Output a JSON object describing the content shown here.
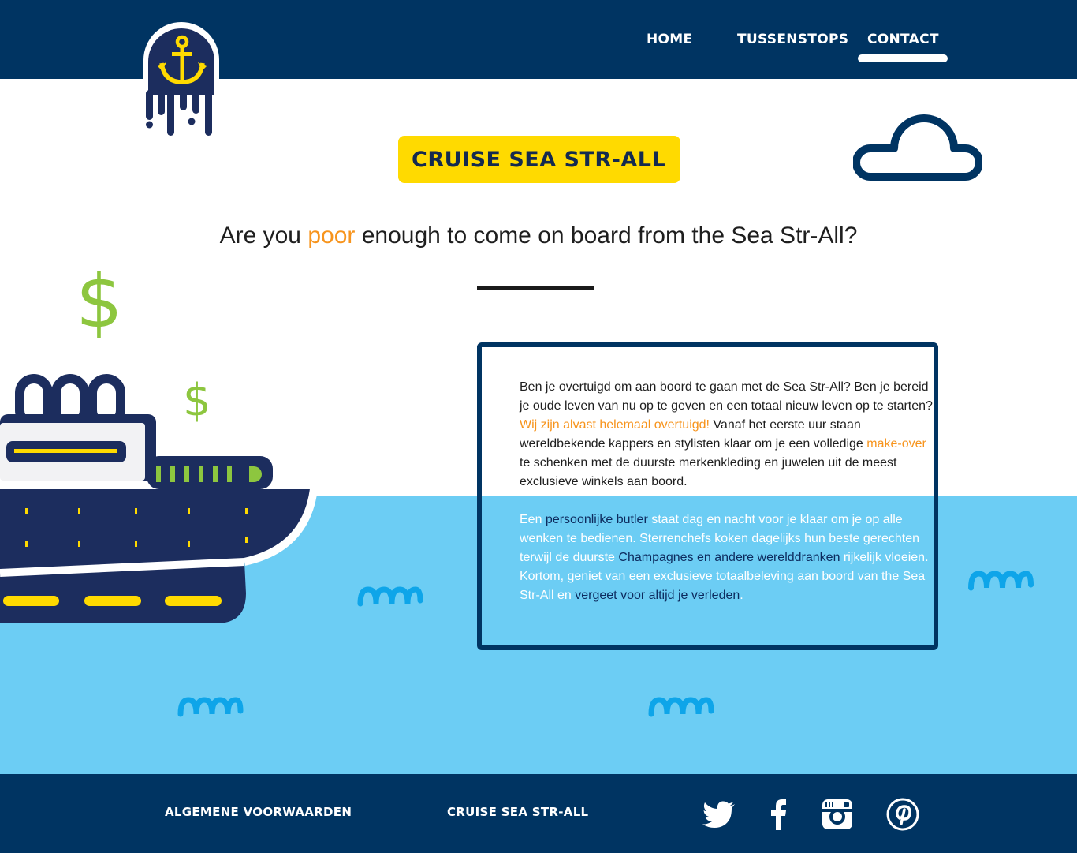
{
  "nav": {
    "items": [
      {
        "label": "HOME",
        "active": false
      },
      {
        "label": "TUSSENSTOPS",
        "active": false
      },
      {
        "label": "CONTACT",
        "active": true
      }
    ]
  },
  "hero": {
    "badge_title": "CRUISE SEA STR-ALL",
    "headline_before": "Are you ",
    "headline_highlight": "poor",
    "headline_after": " enough to come on board from the Sea Str-All?"
  },
  "content": {
    "para1": {
      "text1": "Ben je overtuigd om aan boord te gaan met de Sea Str-All? Ben je bereid je oude leven van nu op te geven en een totaal nieuw leven op te starten? ",
      "highlight1": "Wij zijn alvast helemaal overtuigd!",
      "text2": " Vanaf het eerste uur staan wereldbekende kappers en stylisten klaar om je een volledige ",
      "highlight2": "make-over",
      "text3": " te schenken met de duurste merkenkleding en juwelen uit de meest exclusieve winkels aan boord."
    },
    "para2": {
      "text1": "Een ",
      "highlight1": "persoonlijke butler",
      "text2": " staat dag en nacht voor je klaar om je op alle wenken te bedienen. Sterrenchefs koken dagelijks hun beste gerechten terwijl de duurste ",
      "highlight2": "Champagnes en andere werelddranken",
      "text3": " rijkelijk vloeien. Kortom, geniet van een exclusieve totaalbeleving aan boord van the Sea Str-All en ",
      "highlight3": "vergeet voor altijd je verleden",
      "text4": "."
    }
  },
  "footer": {
    "links": [
      "ALGEMENE VOORWAARDEN",
      "CRUISE SEA STR-ALL"
    ],
    "social_icons": [
      "twitter-icon",
      "facebook-icon",
      "instagram-icon",
      "pinterest-icon"
    ]
  },
  "illustration": {
    "dollar_symbol": "$"
  },
  "colors": {
    "navy": "#003462",
    "yellow": "#ffda00",
    "orange": "#f7941d",
    "sea": "#6ccdf4",
    "wave": "#0ea5e9",
    "green": "#8dc63f",
    "ship": "#1c2d5e"
  }
}
